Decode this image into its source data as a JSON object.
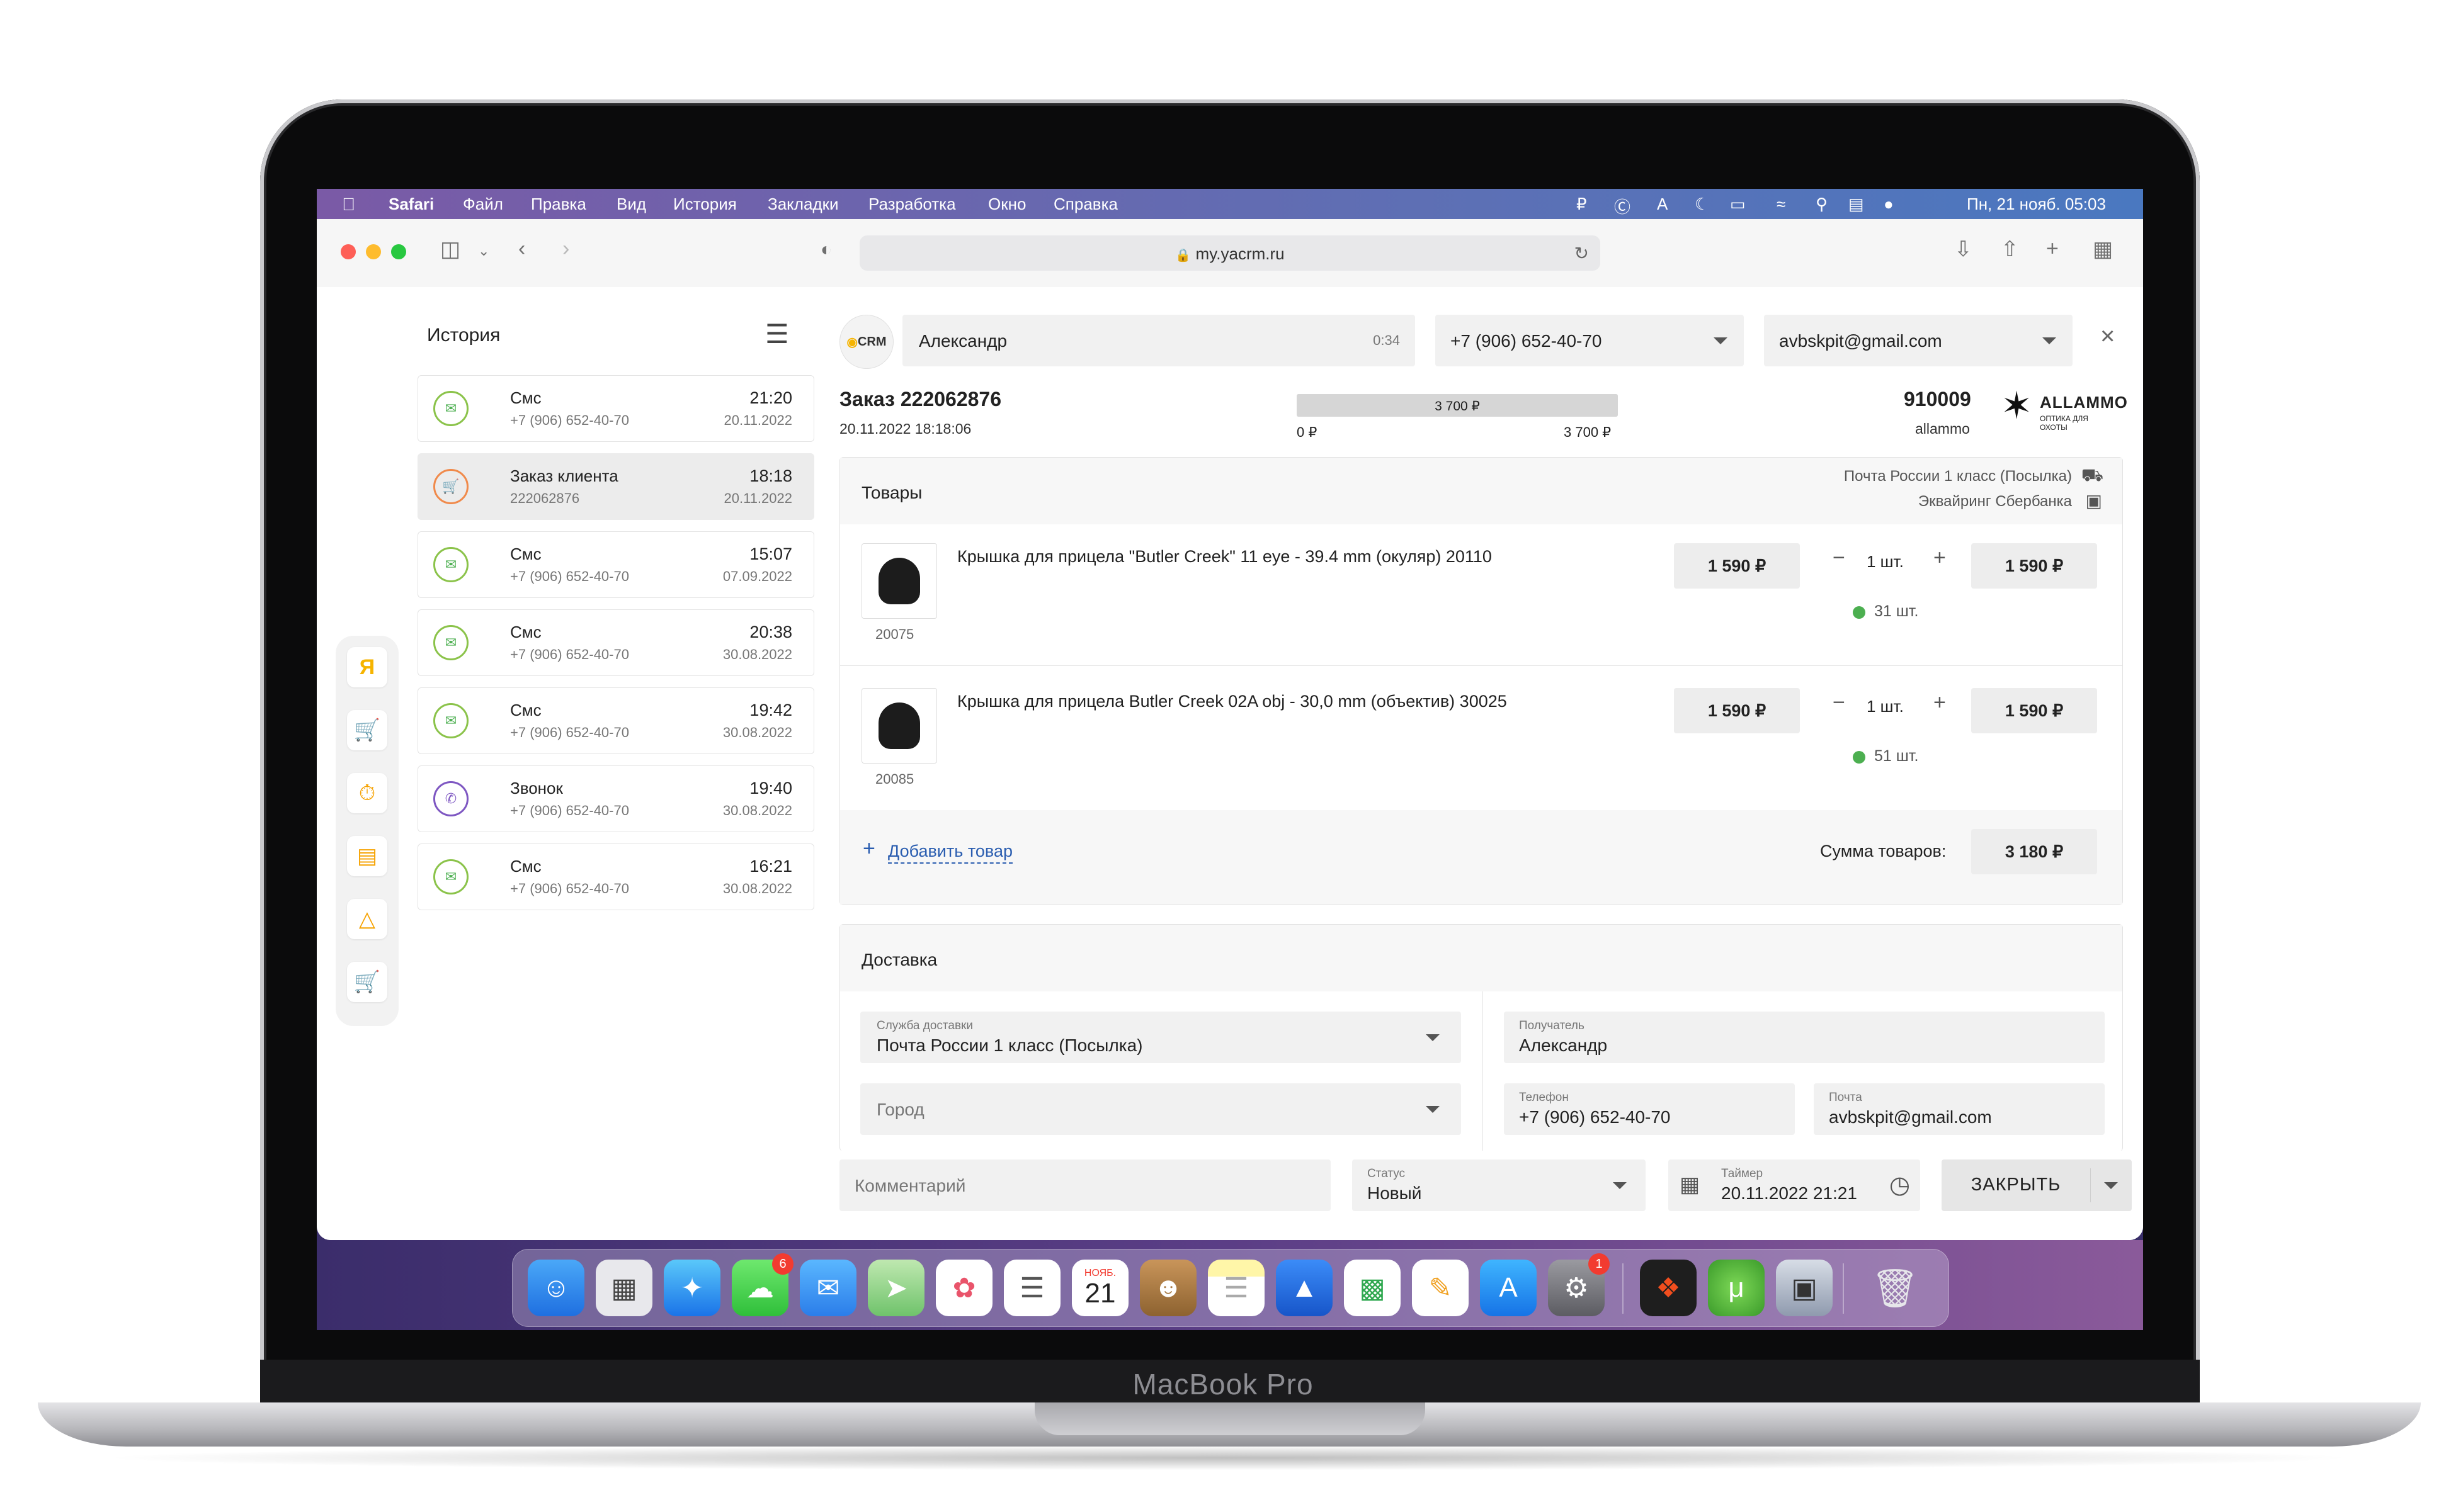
{
  "device": {
    "label": "MacBook Pro"
  },
  "menubar": {
    "app": "Safari",
    "items": [
      "Файл",
      "Правка",
      "Вид",
      "История",
      "Закладки",
      "Разработка",
      "Окно",
      "Справка"
    ],
    "clock": "Пн, 21 нояб.  05:03"
  },
  "browser": {
    "url": "my.yacrm.ru"
  },
  "history": {
    "title": "История",
    "items": [
      {
        "type": "sms",
        "name": "Смс",
        "sub": "+7 (906) 652-40-70",
        "time": "21:20",
        "date": "20.11.2022",
        "selected": false
      },
      {
        "type": "order",
        "name": "Заказ клиента",
        "sub": "222062876",
        "time": "18:18",
        "date": "20.11.2022",
        "selected": true
      },
      {
        "type": "sms",
        "name": "Смс",
        "sub": "+7 (906) 652-40-70",
        "time": "15:07",
        "date": "07.09.2022",
        "selected": false
      },
      {
        "type": "sms",
        "name": "Смс",
        "sub": "+7 (906) 652-40-70",
        "time": "20:38",
        "date": "30.08.2022",
        "selected": false
      },
      {
        "type": "sms",
        "name": "Смс",
        "sub": "+7 (906) 652-40-70",
        "time": "19:42",
        "date": "30.08.2022",
        "selected": false
      },
      {
        "type": "call",
        "name": "Звонок",
        "sub": "+7 (906) 652-40-70",
        "time": "19:40",
        "date": "30.08.2022",
        "selected": false
      },
      {
        "type": "sms",
        "name": "Смс",
        "sub": "+7 (906) 652-40-70",
        "time": "16:21",
        "date": "30.08.2022",
        "selected": false
      }
    ]
  },
  "client": {
    "logo": "CRM",
    "name": "Александр",
    "timer": "0:34",
    "phone": "+7 (906) 652-40-70",
    "email": "avbskpit@gmail.com"
  },
  "order": {
    "title": "Заказ 222062876",
    "datetime": "20.11.2022 18:18:06",
    "paid_fraction": 1.0,
    "progress_label": "3 700 ₽",
    "progress_min": "0 ₽",
    "progress_max": "3 700 ₽",
    "shop_code": "910009",
    "shop_name": "allammo",
    "brand": "ALLAMMO",
    "brand_sub": "ОПТИКА ДЛЯ ОХОТЫ"
  },
  "goods": {
    "title": "Товары",
    "shipping": "Почта России 1 класс (Посылка)",
    "payment": "Эквайринг Сбербанка",
    "items": [
      {
        "name": "Крышка для прицела \"Butler Creek\" 11 eye - 39.4 mm (окуляр) 20110",
        "sku": "20075",
        "price": "1 590 ₽",
        "qty": "1 шт.",
        "total": "1 590 ₽",
        "stock": "31 шт."
      },
      {
        "name": "Крышка для прицела Butler Creek 02A obj - 30,0 mm (объектив) 30025",
        "sku": "20085",
        "price": "1 590 ₽",
        "qty": "1 шт.",
        "total": "1 590 ₽",
        "stock": "51 шт."
      }
    ],
    "add_label": "Добавить товар",
    "sum_label": "Сумма товаров:",
    "sum_value": "3 180 ₽"
  },
  "delivery": {
    "title": "Доставка",
    "service_label": "Служба доставки",
    "service_value": "Почта России 1 класс (Посылка)",
    "city_placeholder": "Город",
    "recipient_label": "Получатель",
    "recipient_value": "Александр",
    "phone_label": "Телефон",
    "phone_value": "+7 (906) 652-40-70",
    "email_label": "Почта",
    "email_value": "avbskpit@gmail.com"
  },
  "footer": {
    "comment_placeholder": "Комментарий",
    "status_label": "Статус",
    "status_value": "Новый",
    "timer_label": "Таймер",
    "timer_value": "20.11.2022 21:21",
    "close_button": "ЗАКРЫТЬ"
  },
  "dock": {
    "calendar_month": "НОЯБ.",
    "calendar_day": "21",
    "messages_badge": "6",
    "settings_badge": "1"
  }
}
